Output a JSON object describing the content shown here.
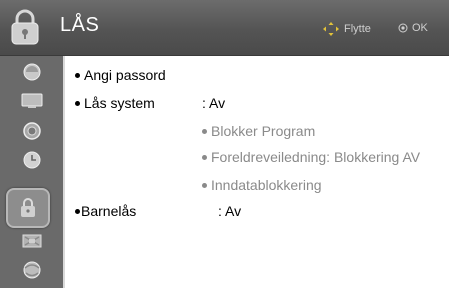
{
  "header": {
    "title": "LÅS",
    "hint_move": "Flytte",
    "hint_ok": "OK",
    "icon": "lock-icon"
  },
  "sidebar": {
    "items": [
      {
        "icon": "picture-icon"
      },
      {
        "icon": "screen-icon"
      },
      {
        "icon": "speaker-icon"
      },
      {
        "icon": "clock-icon"
      },
      {
        "icon": "lock-icon",
        "active": true
      },
      {
        "icon": "option-icon"
      },
      {
        "icon": "network-icon"
      }
    ]
  },
  "menu": {
    "set_password": "Angi passord",
    "lock_system": "Lås system",
    "lock_system_value": ": Av",
    "block_program": "Blokker Program",
    "parental_guidance": "Foreldreveiledning: Blokkering AV",
    "input_block": "Inndatablokkering",
    "child_lock": "Barnelås",
    "child_lock_value": ": Av"
  }
}
